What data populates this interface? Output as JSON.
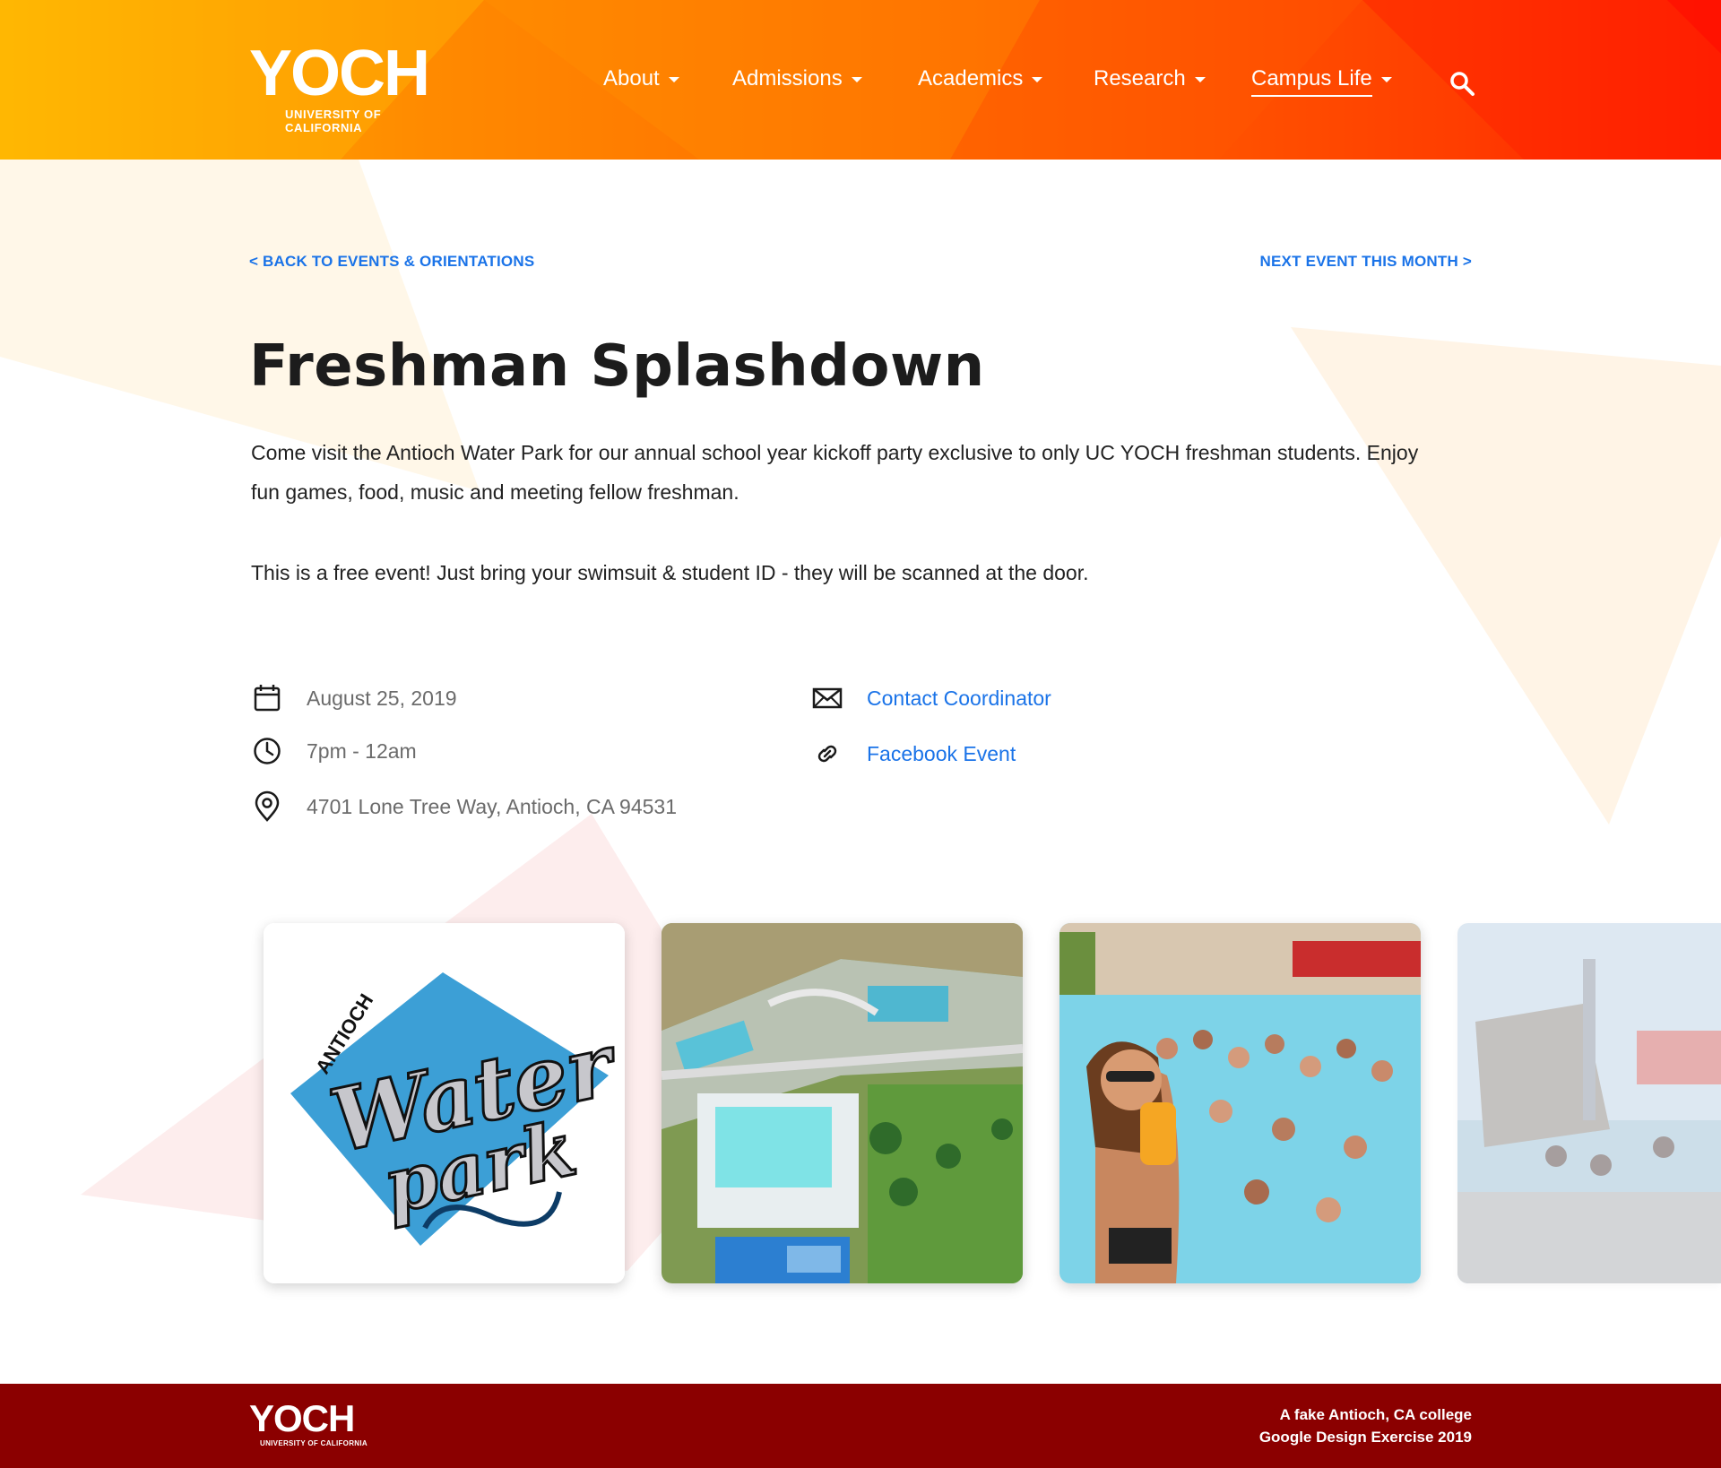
{
  "header": {
    "logo_word": "YOCH",
    "logo_sub": "UNIVERSITY OF CALIFORNIA",
    "nav": [
      {
        "label": "About",
        "active": false
      },
      {
        "label": "Admissions",
        "active": false
      },
      {
        "label": "Academics",
        "active": false
      },
      {
        "label": "Research",
        "active": false
      },
      {
        "label": "Campus Life",
        "active": true
      }
    ],
    "search_icon": "search-icon"
  },
  "links": {
    "back": "< BACK TO EVENTS & ORIENTATIONS",
    "next": "NEXT EVENT THIS MONTH >"
  },
  "event": {
    "title": "Freshman Splashdown",
    "description": "Come visit the Antioch Water Park for our annual school year kickoff party exclusive to only UC YOCH freshman students. Enjoy fun games, food, music and meeting fellow freshman.",
    "note": "This is a free event! Just bring your swimsuit & student ID - they will be scanned at the door.",
    "date": "August 25, 2019",
    "time": "7pm - 12am",
    "address": "4701 Lone Tree Way, Antioch, CA 94531",
    "contact_label": "Contact Coordinator",
    "facebook_label": "Facebook Event"
  },
  "gallery": {
    "logo_top_text": "ANTIOCH",
    "logo_main_text": "Water",
    "logo_second_text": "park"
  },
  "footer": {
    "logo_word": "YOCH",
    "logo_sub": "UNIVERSITY OF CALIFORNIA",
    "line1": "A fake Antioch, CA college",
    "line2": "Google Design Exercise 2019"
  },
  "colors": {
    "accent_link": "#1a73e8",
    "footer_bg": "#8b0000",
    "header_start": "#ffb300",
    "header_end": "#ff1a00"
  }
}
